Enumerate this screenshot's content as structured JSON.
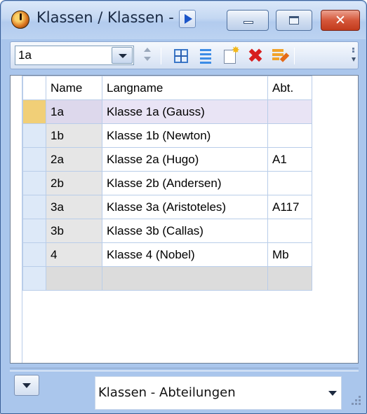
{
  "window": {
    "title": "Klassen / Klassen - A",
    "controls": {
      "minimize": "minimize",
      "maximize": "maximize",
      "close": "✕"
    }
  },
  "toolbar": {
    "class_selector_value": "1a",
    "icons": [
      "grid-view-icon",
      "list-view-icon",
      "new-record-icon",
      "delete-icon",
      "edit-icon"
    ]
  },
  "grid": {
    "columns": [
      "Name",
      "Langname",
      "Abt."
    ],
    "rows": [
      {
        "name": "1a",
        "langname": "Klasse 1a (Gauss)",
        "abt": ""
      },
      {
        "name": "1b",
        "langname": "Klasse 1b (Newton)",
        "abt": ""
      },
      {
        "name": "2a",
        "langname": "Klasse 2a (Hugo)",
        "abt": "A1"
      },
      {
        "name": "2b",
        "langname": "Klasse 2b (Andersen)",
        "abt": ""
      },
      {
        "name": "3a",
        "langname": "Klasse 3a (Aristoteles)",
        "abt": "A117"
      },
      {
        "name": "3b",
        "langname": "Klasse 3b (Callas)",
        "abt": ""
      },
      {
        "name": "4",
        "langname": "Klasse 4 (Nobel)",
        "abt": "Mb"
      },
      {
        "name": "",
        "langname": "",
        "abt": ""
      }
    ],
    "selected_row": 0
  },
  "footer": {
    "view_select_value": "Klassen - Abteilungen"
  },
  "colors": {
    "window_frame": "#aac6ec",
    "selected_row": "#e9e4f5",
    "selected_indicator": "#f1cf77",
    "close_button": "#d5573a"
  }
}
